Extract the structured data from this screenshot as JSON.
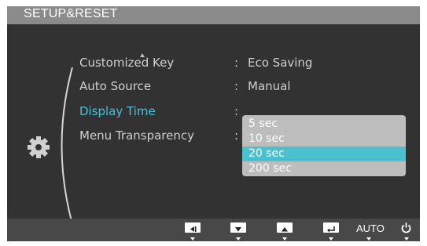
{
  "header": {
    "title": "SETUP&RESET"
  },
  "menu": {
    "items": [
      {
        "label": "Customized Key",
        "value": "Eco Saving"
      },
      {
        "label": "Auto Source",
        "value": "Manual"
      },
      {
        "label": "Display Time",
        "value": ""
      },
      {
        "label": "Menu Transparency",
        "value": ""
      }
    ],
    "selected_index": 2,
    "separator": ":"
  },
  "dropdown": {
    "options": [
      "5 sec",
      "10 sec",
      "20 sec",
      "200 sec"
    ],
    "selected": "20 sec"
  },
  "footer": {
    "auto_label": "AUTO",
    "buttons": [
      "left-icon",
      "down-icon",
      "up-icon",
      "enter-icon",
      "auto",
      "power-icon"
    ]
  },
  "colors": {
    "accent": "#48c2d8",
    "highlight": "#4bc1cf",
    "panel": "#323232",
    "header": "#8b8b8b",
    "footer": "#484848"
  }
}
